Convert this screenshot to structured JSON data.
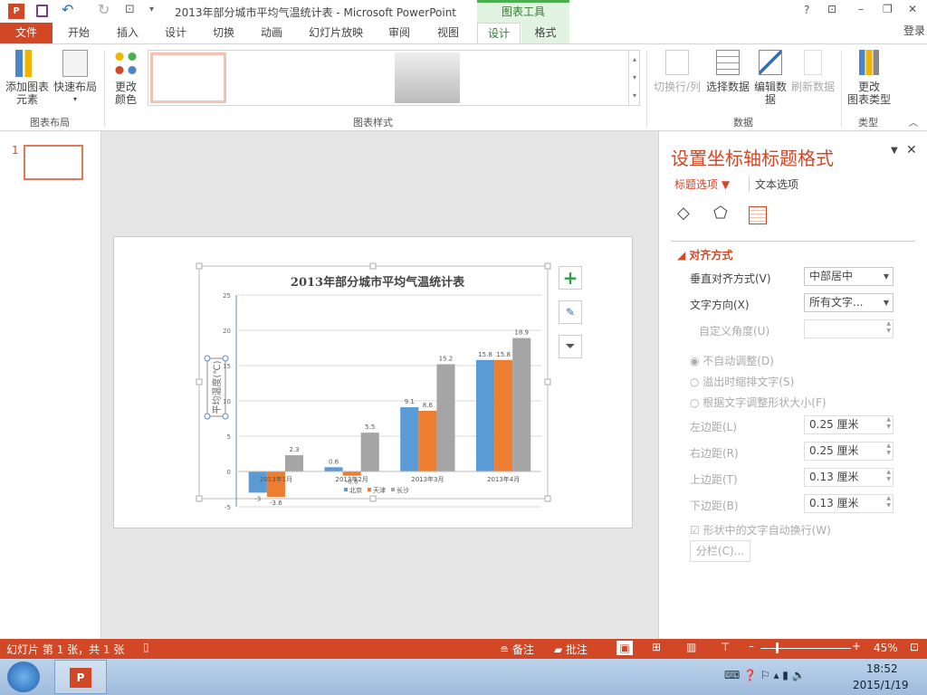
{
  "titlebar": {
    "title": "2013年部分城市平均气温统计表 - Microsoft PowerPoint",
    "context_tab": "图表工具",
    "help": "?",
    "restore_ribbon": "⊡",
    "minimize": "–",
    "maximize": "❐",
    "close": "✕"
  },
  "tabs": [
    "文件",
    "开始",
    "插入",
    "设计",
    "切换",
    "动画",
    "幻灯片放映",
    "审阅",
    "视图",
    "设计",
    "格式"
  ],
  "login": "登录",
  "ribbon": {
    "add_element": [
      "添加图表",
      "元素"
    ],
    "quick_layout": "快速布局",
    "change_color": [
      "更改",
      "颜色"
    ],
    "group_layout": "图表布局",
    "group_styles": "图表样式",
    "switch_rowcol": "切换行/列",
    "select_data": "选择数据",
    "edit_data": [
      "编辑数",
      "据"
    ],
    "refresh_data": "刷新数据",
    "group_data": "数据",
    "change_type": [
      "更改",
      "图表类型"
    ],
    "group_type": "类型"
  },
  "slide_number": "1",
  "chart_data": {
    "type": "bar",
    "title": "2013年部分城市平均气温统计表",
    "ylabel": "平均温度(℃)",
    "categories": [
      "2013年1月",
      "2013年2月",
      "2013年3月",
      "2013年4月"
    ],
    "ylim": [
      -5,
      25
    ],
    "yticks": [
      -5,
      0,
      5,
      10,
      15,
      20,
      25
    ],
    "grid": true,
    "legend_position": "bottom",
    "series": [
      {
        "name": "北京",
        "color": "#5b9bd5",
        "values": [
          -3,
          0.6,
          9.1,
          15.8
        ]
      },
      {
        "name": "天津",
        "color": "#ed7d31",
        "values": [
          -3.6,
          -0.6,
          8.6,
          15.8
        ]
      },
      {
        "name": "长沙",
        "color": "#a5a5a5",
        "values": [
          2.3,
          5.5,
          15.2,
          18.9
        ]
      }
    ]
  },
  "chart_buttons": {
    "add": "+",
    "style": "brush",
    "filter": "filter"
  },
  "panel": {
    "title": "设置坐标轴标题格式",
    "tab_title": "标题选项",
    "tab_text": "文本选项",
    "section": "对齐方式",
    "valign_label": "垂直对齐方式(V)",
    "valign_value": "中部居中",
    "textdir_label": "文字方向(X)",
    "textdir_value": "所有文字...",
    "angle_label": "自定义角度(U)",
    "radio1": "不自动调整(D)",
    "radio2": "溢出时缩排文字(S)",
    "radio3": "根据文字调整形状大小(F)",
    "left_label": "左边距(L)",
    "left_value": "0.25 厘米",
    "right_label": "右边距(R)",
    "right_value": "0.25 厘米",
    "top_label": "上边距(T)",
    "top_value": "0.13 厘米",
    "bottom_label": "下边距(B)",
    "bottom_value": "0.13 厘米",
    "wrap_label": "形状中的文字自动换行(W)",
    "columns_button": "分栏(C)..."
  },
  "status": {
    "slide_info": "幻灯片 第 1 张，共 1 张",
    "notes": "备注",
    "comments": "批注",
    "zoom": "45%"
  },
  "taskbar": {
    "time": "18:52",
    "date": "2015/1/19"
  }
}
